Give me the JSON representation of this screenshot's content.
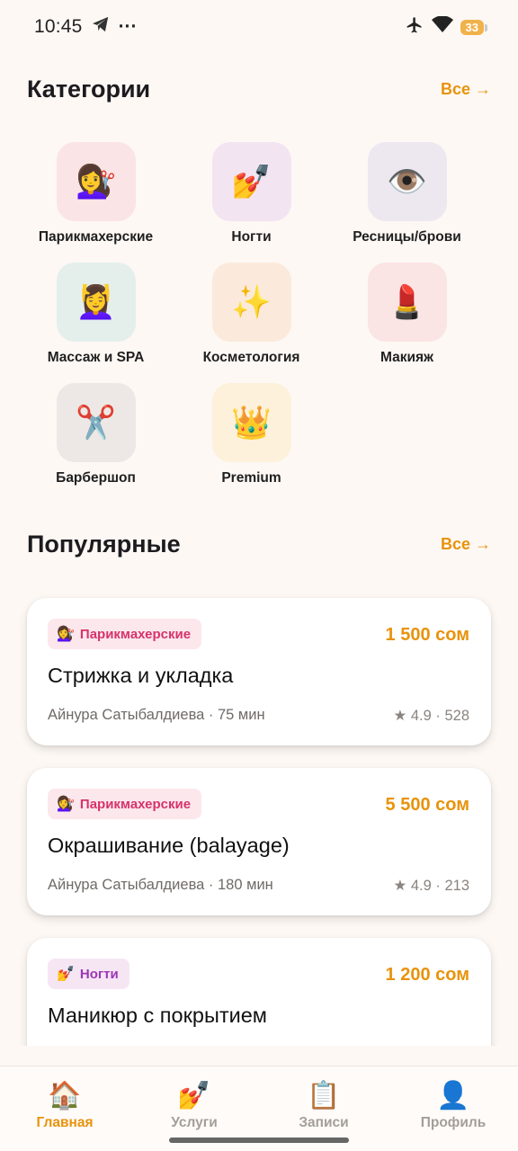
{
  "status_bar": {
    "time": "10:45",
    "telegram_icon": "telegram-icon",
    "more_dots": "···",
    "airplane_icon": "airplane-icon",
    "wifi_icon": "wifi-icon",
    "battery": "33"
  },
  "categories": {
    "title": "Категории",
    "see_all": "Все →",
    "items": [
      {
        "label": "Парикмахерские",
        "emoji": "💇‍♀️",
        "icon": "hairdresser-icon",
        "bg": "#fbe4e6"
      },
      {
        "label": "Ногти",
        "emoji": "💅",
        "icon": "nail-polish-icon",
        "bg": "#f3e4f1"
      },
      {
        "label": "Ресницы/брови",
        "emoji": "👁️",
        "icon": "eye-icon",
        "bg": "#ede8f0"
      },
      {
        "label": "Массаж и SPA",
        "emoji": "💆‍♀️",
        "icon": "massage-icon",
        "bg": "#e4efec"
      },
      {
        "label": "Косметология",
        "emoji": "✨",
        "icon": "sparkles-icon",
        "bg": "#fbeadb"
      },
      {
        "label": "Макияж",
        "emoji": "💄",
        "icon": "lipstick-icon",
        "bg": "#fbe4e4"
      },
      {
        "label": "Барбершоп",
        "emoji": "✂️",
        "icon": "scissors-icon",
        "bg": "#ede8e5"
      },
      {
        "label": "Premium",
        "emoji": "👑",
        "icon": "crown-icon",
        "bg": "#fdf1dc"
      }
    ]
  },
  "popular": {
    "title": "Популярные",
    "see_all": "Все →",
    "cards": [
      {
        "tag": "Парикмахерские",
        "tag_emoji": "💇‍♀️",
        "tag_icon": "hairdresser-icon",
        "tag_bg": "#fce7ec",
        "tag_color": "#d6336c",
        "price": "1 500 сом",
        "title": "Стрижка и укладка",
        "meta": "Айнура Сатыбалдиева · 75 мин",
        "rating": "★ 4.9 · 528"
      },
      {
        "tag": "Парикмахерские",
        "tag_emoji": "💇‍♀️",
        "tag_icon": "hairdresser-icon",
        "tag_bg": "#fce7ec",
        "tag_color": "#d6336c",
        "price": "5 500 сом",
        "title": "Окрашивание (balayage)",
        "meta": "Айнура Сатыбалдиева · 180 мин",
        "rating": "★ 4.9 · 213"
      },
      {
        "tag": "Ногти",
        "tag_emoji": "💅",
        "tag_icon": "nail-polish-icon",
        "tag_bg": "#f6e6f4",
        "tag_color": "#9c36b5",
        "price": "1 200 сом",
        "title": "Маникюр с покрытием",
        "meta": "",
        "rating": ""
      }
    ]
  },
  "bottom_nav": {
    "items": [
      {
        "label": "Главная",
        "emoji": "🏠",
        "icon": "home-icon",
        "active": true
      },
      {
        "label": "Услуги",
        "emoji": "💅",
        "icon": "nail-polish-icon",
        "active": false
      },
      {
        "label": "Записи",
        "emoji": "📋",
        "icon": "clipboard-icon",
        "active": false
      },
      {
        "label": "Профиль",
        "emoji": "👤",
        "icon": "profile-icon",
        "active": false
      }
    ]
  },
  "colors": {
    "background": "#fdf8f4",
    "accent": "#e8930c"
  }
}
